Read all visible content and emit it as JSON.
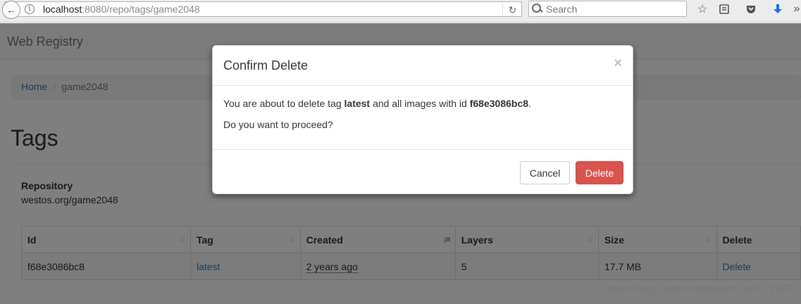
{
  "browser": {
    "url_host": "localhost",
    "url_rest": ":8080/repo/tags/game2048",
    "search_placeholder": "Search"
  },
  "navbar": {
    "brand": "Web Registry"
  },
  "breadcrumb": {
    "home": "Home",
    "current": "game2048"
  },
  "page": {
    "title": "Tags",
    "repo_label": "Repository",
    "repo_value": "westos.org/game2048"
  },
  "table": {
    "headers": [
      "Id",
      "Tag",
      "Created",
      "Layers",
      "Size",
      "Delete"
    ],
    "rows": [
      {
        "id": "f68e3086bc8",
        "tag": "latest",
        "created": "2 years ago",
        "layers": "5",
        "size": "17.7 MB",
        "delete": "Delete"
      }
    ]
  },
  "modal": {
    "title": "Confirm Delete",
    "close": "×",
    "line1_a": "You are about to delete tag ",
    "tag": "latest",
    "line1_b": " and all images with id ",
    "image_id": "f68e3086bc8",
    "line1_c": ".",
    "line2": "Do you want to proceed?",
    "cancel_label": "Cancel",
    "delete_label": "Delete"
  },
  "watermark": "https://blog.csdn.net/weixin_40172997",
  "colors": {
    "danger": "#d9534f",
    "link": "#337ab7"
  }
}
